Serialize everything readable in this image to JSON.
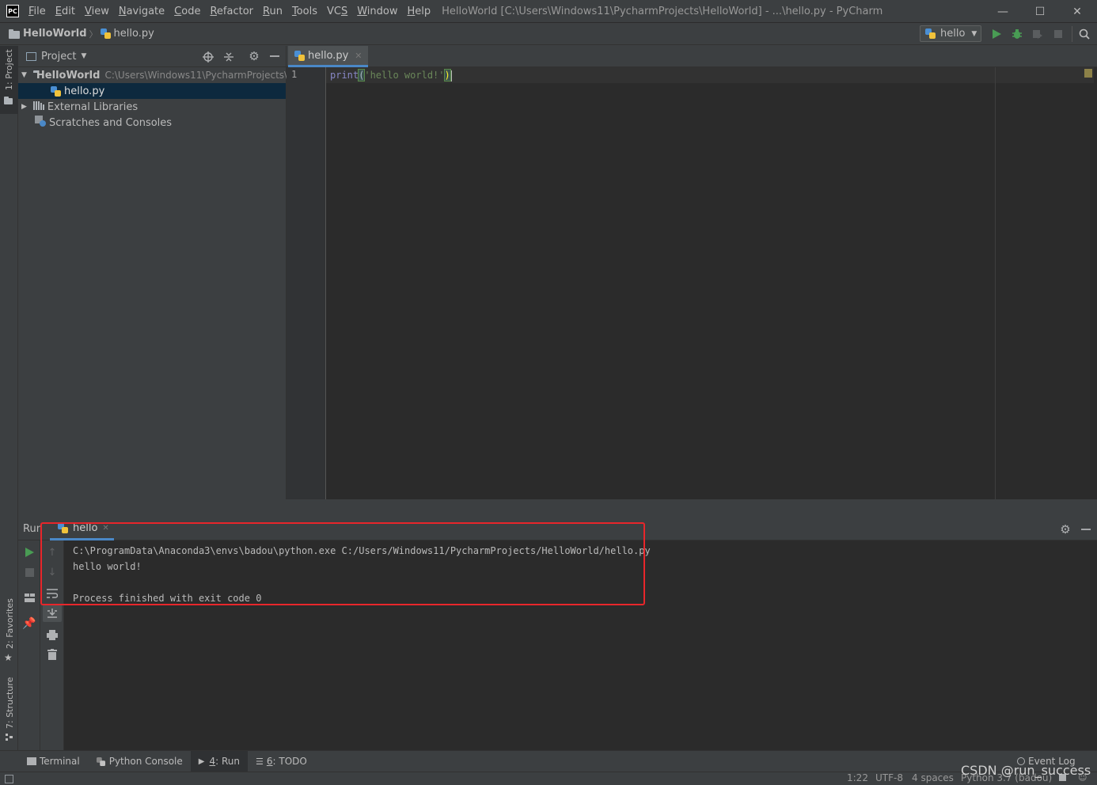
{
  "app": {
    "logo_text": "PC",
    "window_title": "HelloWorld [C:\\Users\\Windows11\\PycharmProjects\\HelloWorld] - ...\\hello.py - PyCharm"
  },
  "menu": {
    "items": [
      {
        "mnemonic": "F",
        "rest": "ile"
      },
      {
        "mnemonic": "E",
        "rest": "dit"
      },
      {
        "mnemonic": "V",
        "rest": "iew"
      },
      {
        "mnemonic": "N",
        "rest": "avigate"
      },
      {
        "mnemonic": "C",
        "rest": "ode"
      },
      {
        "mnemonic": "R",
        "rest": "efactor"
      },
      {
        "mnemonic": "R",
        "rest": "un",
        "pre": ""
      },
      {
        "mnemonic": "T",
        "rest": "ools"
      },
      {
        "pre": "VC",
        "mnemonic": "S",
        "rest": ""
      },
      {
        "mnemonic": "W",
        "rest": "indow"
      },
      {
        "mnemonic": "H",
        "rest": "elp"
      }
    ]
  },
  "window_controls": {
    "minimize": "—",
    "maximize": "☐",
    "close": "✕"
  },
  "navbar": {
    "project": "HelloWorld",
    "separator": "〉",
    "file": "hello.py",
    "run_config": "hello"
  },
  "left_stripe": {
    "project_label": "1: Project",
    "favorites_label": "2: Favorites",
    "structure_label": "7: Structure"
  },
  "project_panel": {
    "title": "Project",
    "tree": {
      "root_name": "HelloWorld",
      "root_path": "C:\\Users\\Windows11\\PycharmProjects\\",
      "file": "hello.py",
      "external": "External Libraries",
      "scratches": "Scratches and Consoles"
    }
  },
  "editor": {
    "tab_label": "hello.py",
    "line_number": "1",
    "code": {
      "fn": "print",
      "open": "(",
      "string": "'hello world!'",
      "close": ")"
    }
  },
  "run_window": {
    "label": "Run",
    "tab_label": "hello",
    "console_lines": [
      "C:\\ProgramData\\Anaconda3\\envs\\badou\\python.exe C:/Users/Windows11/PycharmProjects/HelloWorld/hello.py",
      "hello world!",
      "",
      "Process finished with exit code 0"
    ]
  },
  "bottom_tabs": {
    "terminal": "Terminal",
    "python_console": "Python Console",
    "run_num": "4",
    "run": ": Run",
    "todo_num": "6",
    "todo": ": TODO",
    "event_log": "Event Log"
  },
  "statusbar": {
    "position": "1:22",
    "encoding": "UTF-8",
    "indent": "4 spaces",
    "interpreter": "Python 3.7 (badou)",
    "watermark": "CSDN @run_success"
  },
  "colors": {
    "accent": "#4a88c7",
    "highlight_box": "#e8262b",
    "run_green": "#499c54",
    "string_green": "#6a8759",
    "keyword_blue": "#8888c6"
  }
}
